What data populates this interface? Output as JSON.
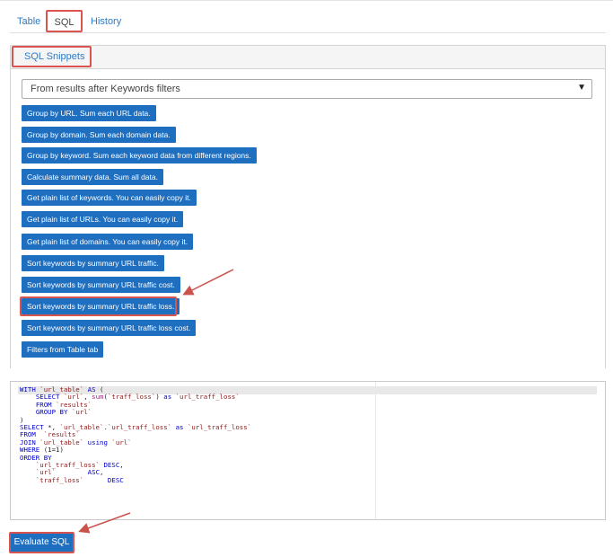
{
  "tabs": [
    {
      "label": "Table"
    },
    {
      "label": "SQL"
    },
    {
      "label": "History"
    }
  ],
  "snippets_panel": {
    "title": "SQL Snippets",
    "select_value": "From results after Keywords filters",
    "buttons": [
      "Group by URL. Sum each URL data.",
      "Group by domain. Sum each domain data.",
      "Group by keyword. Sum each keyword data from different regions.",
      "Calculate summary data. Sum all data.",
      "Get plain list of keywords. You can easily copy it.",
      "Get plain list of URLs. You can easily copy it.",
      "Get plain list of domains. You can easily copy it.",
      "Sort keywords by summary URL traffic.",
      "Sort keywords by summary URL traffic cost.",
      "Sort keywords by summary URL traffic loss.",
      "Sort keywords by summary URL traffic loss cost.",
      "Filters from Table tab"
    ]
  },
  "editor": {
    "lines": [
      "WITH `url_table` AS (",
      "    SELECT `url`, sum(`traff_loss`) as `url_traff_loss`",
      "    FROM `results`",
      "    GROUP BY `url`",
      ")",
      "SELECT *, `url_table`.`url_traff_loss` as `url_traff_loss`",
      "FROM  `results`",
      "JOIN `url_table` using `url`",
      "WHERE (1=1)",
      "ORDER BY",
      "    `url_traff_loss` DESC,",
      "    `url`        ASC,",
      "    `traff_loss`      DESC"
    ]
  },
  "evaluate_button": "Evaluate SQL",
  "colors": {
    "accent": "#1f6fc0",
    "link": "#2e7bc4",
    "highlight": "#d9534f"
  }
}
